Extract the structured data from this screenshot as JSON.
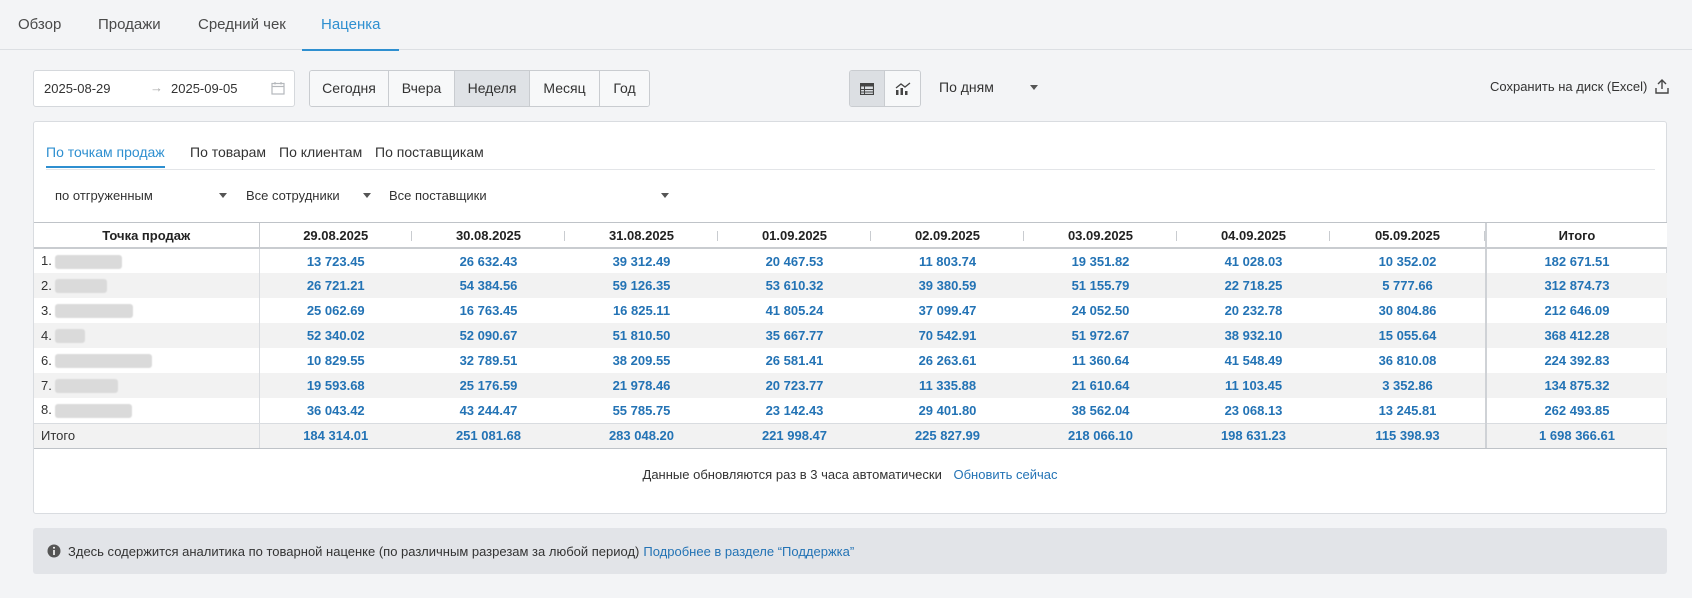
{
  "top_tabs": [
    {
      "label": "Обзор"
    },
    {
      "label": "Продажи"
    },
    {
      "label": "Средний чек"
    },
    {
      "label": "Наценка",
      "active": true
    }
  ],
  "date_range": {
    "from": "2025-08-29",
    "arrow": "→",
    "to": "2025-09-05"
  },
  "periods": [
    {
      "label": "Сегодня"
    },
    {
      "label": "Вчера"
    },
    {
      "label": "Неделя",
      "active": true
    },
    {
      "label": "Месяц"
    },
    {
      "label": "Год"
    }
  ],
  "view_toggle": {
    "active": "table-icon",
    "icons": [
      "table-icon",
      "chart-icon"
    ]
  },
  "group_by": {
    "value": "По дням"
  },
  "save": {
    "label": "Сохранить на диск (Excel)"
  },
  "sub_tabs": [
    {
      "label": "По точкам продаж",
      "active": true
    },
    {
      "label": "По товарам"
    },
    {
      "label": "По клиентам"
    },
    {
      "label": "По поставщикам"
    }
  ],
  "filters": {
    "shipment": "по отгруженным",
    "employees": "Все сотрудники",
    "suppliers": "Все поставщики"
  },
  "table": {
    "columns": [
      "Точка продаж",
      "29.08.2025",
      "30.08.2025",
      "31.08.2025",
      "01.09.2025",
      "02.09.2025",
      "03.09.2025",
      "04.09.2025",
      "05.09.2025",
      "Итого"
    ],
    "rows": [
      {
        "num": "1.",
        "values": [
          "13 723.45",
          "26 632.43",
          "39 312.49",
          "20 467.53",
          "11 803.74",
          "19 351.82",
          "41 028.03",
          "10 352.02"
        ],
        "total": "182 671.51"
      },
      {
        "num": "2.",
        "values": [
          "26 721.21",
          "54 384.56",
          "59 126.35",
          "53 610.32",
          "39 380.59",
          "51 155.79",
          "22 718.25",
          "5 777.66"
        ],
        "total": "312 874.73"
      },
      {
        "num": "3.",
        "values": [
          "25 062.69",
          "16 763.45",
          "16 825.11",
          "41 805.24",
          "37 099.47",
          "24 052.50",
          "20 232.78",
          "30 804.86"
        ],
        "total": "212 646.09"
      },
      {
        "num": "4.",
        "values": [
          "52 340.02",
          "52 090.67",
          "51 810.50",
          "35 667.77",
          "70 542.91",
          "51 972.67",
          "38 932.10",
          "15 055.64"
        ],
        "total": "368 412.28"
      },
      {
        "num": "6.",
        "values": [
          "10 829.55",
          "32 789.51",
          "38 209.55",
          "26 581.41",
          "26 263.61",
          "11 360.64",
          "41 548.49",
          "36 810.08"
        ],
        "total": "224 392.83"
      },
      {
        "num": "7.",
        "values": [
          "19 593.68",
          "25 176.59",
          "21 978.46",
          "20 723.77",
          "11 335.88",
          "21 610.64",
          "11 103.45",
          "3 352.86"
        ],
        "total": "134 875.32"
      },
      {
        "num": "8.",
        "values": [
          "36 043.42",
          "43 244.47",
          "55 785.75",
          "23 142.43",
          "29 401.80",
          "38 562.04",
          "23 068.13",
          "13 245.81"
        ],
        "total": "262 493.85"
      }
    ],
    "total_row": {
      "label": "Итого",
      "values": [
        "184 314.01",
        "251 081.68",
        "283 048.20",
        "221 998.47",
        "225 827.99",
        "218 066.10",
        "198 631.23",
        "115 398.93"
      ],
      "total": "1 698 366.61"
    }
  },
  "update_note": {
    "text": "Данные обновляются раз в 3 часа автоматически",
    "link": "Обновить сейчас"
  },
  "info": {
    "text": "Здесь содержится аналитика по товарной наценке (по различным разрезам за любой период)",
    "link": "Подробнее в разделе “Поддержка”"
  }
}
